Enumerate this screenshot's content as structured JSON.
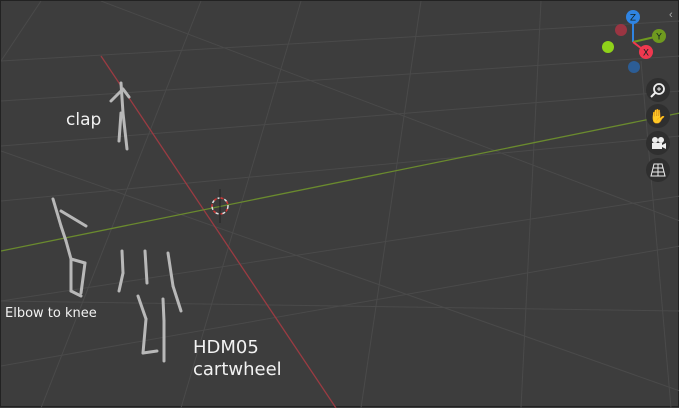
{
  "labels": {
    "clap": "clap",
    "elbow": "Elbow to knee",
    "hdm_line1": "HDM05",
    "hdm_line2": "cartwheel"
  },
  "gizmo": {
    "x": "X",
    "y": "Y",
    "z": "Z",
    "colors": {
      "x": "#f0384f",
      "y": "#6f9a1f",
      "z": "#2f84e3",
      "neg_x": "#9a3542",
      "neg_y": "#8fd21a",
      "neg_z": "#2c5d95"
    }
  },
  "nav_buttons": [
    "zoom-icon",
    "pan-hand-icon",
    "camera-icon",
    "perspective-grid-icon"
  ],
  "colors": {
    "background": "#3d3d3d",
    "grid": "#4a4a4a",
    "x_axis": "#9a3b42",
    "y_axis": "#6a8a2e"
  }
}
